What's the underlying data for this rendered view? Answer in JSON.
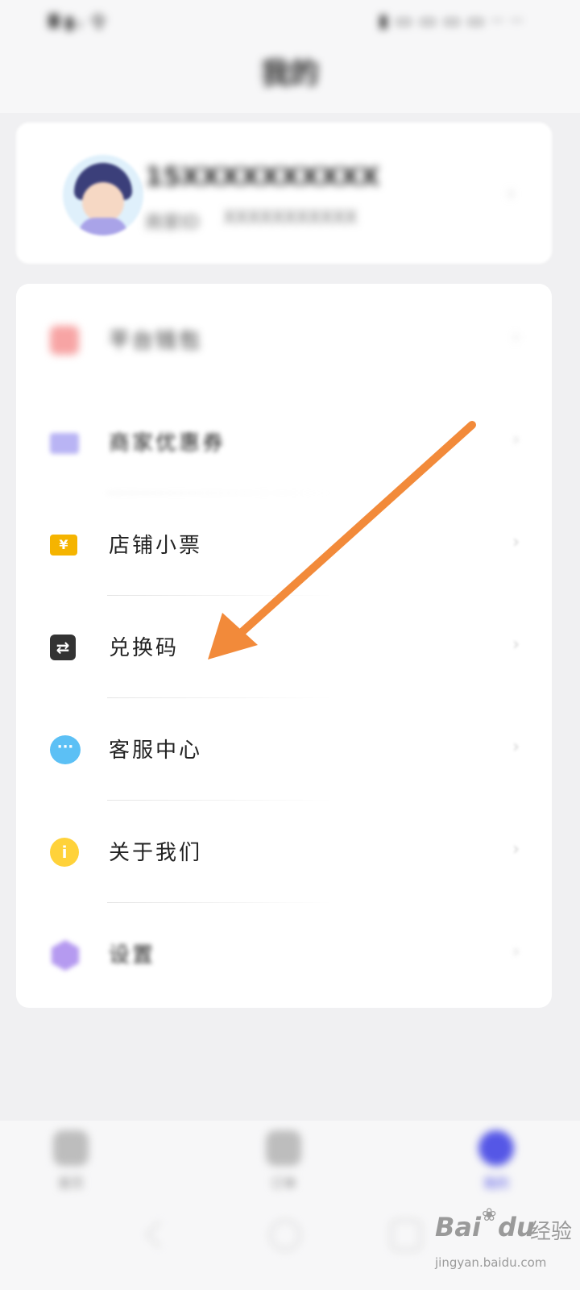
{
  "status_bar": {
    "left": "▮ᵢₗ 令",
    "right": "▮ ▭ ▭ ▭ ▭ ·· ··"
  },
  "header": {
    "title": "我的"
  },
  "profile": {
    "phone": "15XXXXXXXXXX",
    "member_label": "商家ID",
    "member_id": "XXXXXXXXXXX"
  },
  "menu": {
    "items": [
      {
        "label": "平台钱包",
        "icon": "wallet-icon",
        "color": "#f7a4a4"
      },
      {
        "label": "商家优惠券",
        "icon": "coupon-icon",
        "color": "#b9b4f4"
      },
      {
        "label": "店铺小票",
        "icon": "receipt-ticket-icon",
        "color": "#f5b400",
        "glyph": "¥"
      },
      {
        "label": "兑换码",
        "icon": "exchange-icon",
        "color": "#333333",
        "glyph": "⇄"
      },
      {
        "label": "客服中心",
        "icon": "chat-bubble-icon",
        "color": "#5cc0f5",
        "glyph": "···"
      },
      {
        "label": "关于我们",
        "icon": "info-icon",
        "color": "#ffd23a",
        "glyph": "i"
      },
      {
        "label": "设置",
        "icon": "settings-hexagon-icon",
        "color": "#b59af0"
      }
    ],
    "chevron": "›"
  },
  "bottom_nav": {
    "tabs": [
      {
        "label": "首页",
        "icon": "home-icon"
      },
      {
        "label": "订单",
        "icon": "orders-icon"
      },
      {
        "label": "我的",
        "icon": "profile-icon",
        "active": true
      }
    ]
  },
  "annotation": {
    "arrow_color": "#f28a3a",
    "points_to": "兑换码"
  },
  "watermark": {
    "brand_a": "Bai",
    "paw": "❀",
    "brand_b": "du",
    "cn": "经验",
    "url": "jingyan.baidu.com"
  }
}
